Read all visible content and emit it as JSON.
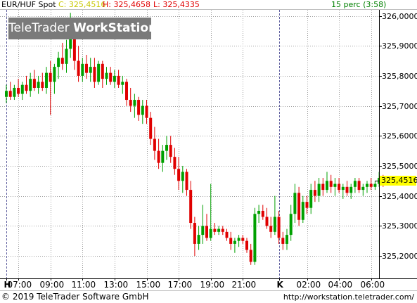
{
  "header": {
    "symbol": "EUR/HUF Spot",
    "close_label": "C: 325,4516",
    "high_label": "H: 325,4658",
    "low_label": "L: 325,4335",
    "interval": "15 perc (3:58)"
  },
  "watermark": {
    "brand_light": "TeleTrader",
    "brand_bold": "WorkStation"
  },
  "colors": {
    "up": "#00a000",
    "down": "#e00000",
    "grid": "#a0a0a0",
    "current_price_tag": "#ffff00",
    "close_text": "#c8c800",
    "high_low_text": "#e00000",
    "interval_text": "#008000",
    "watermark_bg": "#7a7a7a"
  },
  "footer": {
    "copyright": "© 2019 TeleTrader Software GmbH",
    "url": "http://workstation.teletrader.com/"
  },
  "chart_data": {
    "type": "candlestick",
    "title": "EUR/HUF Spot",
    "interval": "15 perc",
    "ylim": [
      325.125,
      326.02
    ],
    "y_ticks": [
      {
        "value": 325.2,
        "label": "325,2000"
      },
      {
        "value": 325.3,
        "label": "325,3000"
      },
      {
        "value": 325.4,
        "label": "325,4000"
      },
      {
        "value": 325.5,
        "label": "325,5000"
      },
      {
        "value": 325.6,
        "label": "325,6000"
      },
      {
        "value": 325.7,
        "label": "325,7000"
      },
      {
        "value": 325.8,
        "label": "325,8000"
      },
      {
        "value": 325.9,
        "label": "325,9000"
      },
      {
        "value": 326.0,
        "label": "326,0000"
      }
    ],
    "current_price": 325.4516,
    "current_price_label": "325,4516",
    "x_ticks": [
      {
        "index": 0,
        "label": "H"
      },
      {
        "index": 3,
        "label": "07:00"
      },
      {
        "index": 11,
        "label": "09:00"
      },
      {
        "index": 19,
        "label": "11:00"
      },
      {
        "index": 27,
        "label": "13:00"
      },
      {
        "index": 35,
        "label": "15:00"
      },
      {
        "index": 43,
        "label": "17:00"
      },
      {
        "index": 51,
        "label": "19:00"
      },
      {
        "index": 59,
        "label": "21:00"
      },
      {
        "index": 68,
        "label": "K"
      },
      {
        "index": 75,
        "label": "02:00"
      },
      {
        "index": 83,
        "label": "04:00"
      },
      {
        "index": 91,
        "label": "06:00"
      }
    ],
    "grid": true,
    "candles": [
      {
        "o": 325.73,
        "h": 325.77,
        "l": 325.71,
        "c": 325.75
      },
      {
        "o": 325.75,
        "h": 325.78,
        "l": 325.72,
        "c": 325.73
      },
      {
        "o": 325.73,
        "h": 325.77,
        "l": 325.72,
        "c": 325.76
      },
      {
        "o": 325.76,
        "h": 325.79,
        "l": 325.73,
        "c": 325.74
      },
      {
        "o": 325.74,
        "h": 325.78,
        "l": 325.72,
        "c": 325.77
      },
      {
        "o": 325.77,
        "h": 325.8,
        "l": 325.74,
        "c": 325.75
      },
      {
        "o": 325.75,
        "h": 325.81,
        "l": 325.73,
        "c": 325.79
      },
      {
        "o": 325.79,
        "h": 325.82,
        "l": 325.75,
        "c": 325.76
      },
      {
        "o": 325.76,
        "h": 325.8,
        "l": 325.74,
        "c": 325.78
      },
      {
        "o": 325.78,
        "h": 325.81,
        "l": 325.75,
        "c": 325.76
      },
      {
        "o": 325.76,
        "h": 325.83,
        "l": 325.74,
        "c": 325.81
      },
      {
        "o": 325.81,
        "h": 325.85,
        "l": 325.67,
        "c": 325.78
      },
      {
        "o": 325.78,
        "h": 325.84,
        "l": 325.74,
        "c": 325.83
      },
      {
        "o": 325.83,
        "h": 325.88,
        "l": 325.79,
        "c": 325.86
      },
      {
        "o": 325.86,
        "h": 325.91,
        "l": 325.82,
        "c": 325.84
      },
      {
        "o": 325.84,
        "h": 325.92,
        "l": 325.81,
        "c": 325.89
      },
      {
        "o": 325.89,
        "h": 326.01,
        "l": 325.86,
        "c": 325.94
      },
      {
        "o": 325.94,
        "h": 325.97,
        "l": 325.82,
        "c": 325.85
      },
      {
        "o": 325.85,
        "h": 325.9,
        "l": 325.78,
        "c": 325.8
      },
      {
        "o": 325.8,
        "h": 325.86,
        "l": 325.78,
        "c": 325.84
      },
      {
        "o": 325.84,
        "h": 325.87,
        "l": 325.79,
        "c": 325.81
      },
      {
        "o": 325.81,
        "h": 325.86,
        "l": 325.78,
        "c": 325.83
      },
      {
        "o": 325.83,
        "h": 325.86,
        "l": 325.76,
        "c": 325.78
      },
      {
        "o": 325.78,
        "h": 325.85,
        "l": 325.77,
        "c": 325.84
      },
      {
        "o": 325.84,
        "h": 325.85,
        "l": 325.76,
        "c": 325.79
      },
      {
        "o": 325.79,
        "h": 325.83,
        "l": 325.77,
        "c": 325.81
      },
      {
        "o": 325.81,
        "h": 325.83,
        "l": 325.77,
        "c": 325.78
      },
      {
        "o": 325.78,
        "h": 325.82,
        "l": 325.76,
        "c": 325.8
      },
      {
        "o": 325.8,
        "h": 325.82,
        "l": 325.76,
        "c": 325.77
      },
      {
        "o": 325.77,
        "h": 325.8,
        "l": 325.74,
        "c": 325.78
      },
      {
        "o": 325.78,
        "h": 325.79,
        "l": 325.7,
        "c": 325.72
      },
      {
        "o": 325.72,
        "h": 325.76,
        "l": 325.68,
        "c": 325.7
      },
      {
        "o": 325.7,
        "h": 325.74,
        "l": 325.66,
        "c": 325.72
      },
      {
        "o": 325.72,
        "h": 325.73,
        "l": 325.65,
        "c": 325.67
      },
      {
        "o": 325.67,
        "h": 325.72,
        "l": 325.64,
        "c": 325.7
      },
      {
        "o": 325.7,
        "h": 325.72,
        "l": 325.64,
        "c": 325.66
      },
      {
        "o": 325.66,
        "h": 325.68,
        "l": 325.57,
        "c": 325.59
      },
      {
        "o": 325.59,
        "h": 325.63,
        "l": 325.52,
        "c": 325.55
      },
      {
        "o": 325.55,
        "h": 325.59,
        "l": 325.49,
        "c": 325.51
      },
      {
        "o": 325.51,
        "h": 325.57,
        "l": 325.48,
        "c": 325.55
      },
      {
        "o": 325.55,
        "h": 325.6,
        "l": 325.52,
        "c": 325.57
      },
      {
        "o": 325.57,
        "h": 325.6,
        "l": 325.51,
        "c": 325.53
      },
      {
        "o": 325.53,
        "h": 325.56,
        "l": 325.47,
        "c": 325.49
      },
      {
        "o": 325.49,
        "h": 325.53,
        "l": 325.42,
        "c": 325.45
      },
      {
        "o": 325.45,
        "h": 325.5,
        "l": 325.41,
        "c": 325.48
      },
      {
        "o": 325.48,
        "h": 325.49,
        "l": 325.4,
        "c": 325.42
      },
      {
        "o": 325.42,
        "h": 325.45,
        "l": 325.29,
        "c": 325.31
      },
      {
        "o": 325.31,
        "h": 325.33,
        "l": 325.2,
        "c": 325.24
      },
      {
        "o": 325.24,
        "h": 325.3,
        "l": 325.22,
        "c": 325.27
      },
      {
        "o": 325.27,
        "h": 325.37,
        "l": 325.24,
        "c": 325.3
      },
      {
        "o": 325.3,
        "h": 325.34,
        "l": 325.25,
        "c": 325.26
      },
      {
        "o": 325.26,
        "h": 325.44,
        "l": 325.25,
        "c": 325.29
      },
      {
        "o": 325.29,
        "h": 325.31,
        "l": 325.27,
        "c": 325.28
      },
      {
        "o": 325.28,
        "h": 325.3,
        "l": 325.27,
        "c": 325.29
      },
      {
        "o": 325.29,
        "h": 325.3,
        "l": 325.27,
        "c": 325.28
      },
      {
        "o": 325.28,
        "h": 325.29,
        "l": 325.25,
        "c": 325.26
      },
      {
        "o": 325.26,
        "h": 325.28,
        "l": 325.22,
        "c": 325.24
      },
      {
        "o": 325.24,
        "h": 325.26,
        "l": 325.21,
        "c": 325.25
      },
      {
        "o": 325.25,
        "h": 325.27,
        "l": 325.23,
        "c": 325.26
      },
      {
        "o": 325.26,
        "h": 325.27,
        "l": 325.24,
        "c": 325.25
      },
      {
        "o": 325.25,
        "h": 325.26,
        "l": 325.21,
        "c": 325.22
      },
      {
        "o": 325.22,
        "h": 325.24,
        "l": 325.17,
        "c": 325.18
      },
      {
        "o": 325.18,
        "h": 325.36,
        "l": 325.17,
        "c": 325.34
      },
      {
        "o": 325.34,
        "h": 325.37,
        "l": 325.31,
        "c": 325.35
      },
      {
        "o": 325.35,
        "h": 325.37,
        "l": 325.32,
        "c": 325.33
      },
      {
        "o": 325.33,
        "h": 325.36,
        "l": 325.29,
        "c": 325.3
      },
      {
        "o": 325.3,
        "h": 325.33,
        "l": 325.26,
        "c": 325.28
      },
      {
        "o": 325.28,
        "h": 325.4,
        "l": 325.27,
        "c": 325.33
      },
      {
        "o": 325.33,
        "h": 325.35,
        "l": 325.24,
        "c": 325.26
      },
      {
        "o": 325.26,
        "h": 325.28,
        "l": 325.22,
        "c": 325.24
      },
      {
        "o": 325.24,
        "h": 325.29,
        "l": 325.22,
        "c": 325.27
      },
      {
        "o": 325.27,
        "h": 325.37,
        "l": 325.25,
        "c": 325.34
      },
      {
        "o": 325.34,
        "h": 325.44,
        "l": 325.31,
        "c": 325.41
      },
      {
        "o": 325.41,
        "h": 325.43,
        "l": 325.3,
        "c": 325.32
      },
      {
        "o": 325.32,
        "h": 325.4,
        "l": 325.31,
        "c": 325.38
      },
      {
        "o": 325.38,
        "h": 325.4,
        "l": 325.34,
        "c": 325.36
      },
      {
        "o": 325.36,
        "h": 325.44,
        "l": 325.34,
        "c": 325.42
      },
      {
        "o": 325.42,
        "h": 325.45,
        "l": 325.38,
        "c": 325.4
      },
      {
        "o": 325.4,
        "h": 325.46,
        "l": 325.38,
        "c": 325.44
      },
      {
        "o": 325.44,
        "h": 325.46,
        "l": 325.4,
        "c": 325.42
      },
      {
        "o": 325.42,
        "h": 325.48,
        "l": 325.41,
        "c": 325.45
      },
      {
        "o": 325.45,
        "h": 325.47,
        "l": 325.41,
        "c": 325.43
      },
      {
        "o": 325.43,
        "h": 325.46,
        "l": 325.4,
        "c": 325.44
      },
      {
        "o": 325.44,
        "h": 325.46,
        "l": 325.41,
        "c": 325.42
      },
      {
        "o": 325.42,
        "h": 325.44,
        "l": 325.39,
        "c": 325.43
      },
      {
        "o": 325.43,
        "h": 325.45,
        "l": 325.4,
        "c": 325.41
      },
      {
        "o": 325.41,
        "h": 325.44,
        "l": 325.39,
        "c": 325.43
      },
      {
        "o": 325.43,
        "h": 325.46,
        "l": 325.41,
        "c": 325.45
      },
      {
        "o": 325.45,
        "h": 325.46,
        "l": 325.41,
        "c": 325.42
      },
      {
        "o": 325.42,
        "h": 325.44,
        "l": 325.4,
        "c": 325.43
      },
      {
        "o": 325.43,
        "h": 325.45,
        "l": 325.41,
        "c": 325.44
      },
      {
        "o": 325.44,
        "h": 325.46,
        "l": 325.42,
        "c": 325.43
      },
      {
        "o": 325.43,
        "h": 325.45,
        "l": 325.42,
        "c": 325.44
      },
      {
        "o": 325.44,
        "h": 325.48,
        "l": 325.43,
        "c": 325.46
      },
      {
        "o": 325.46,
        "h": 325.47,
        "l": 325.43,
        "c": 325.45
      }
    ]
  }
}
